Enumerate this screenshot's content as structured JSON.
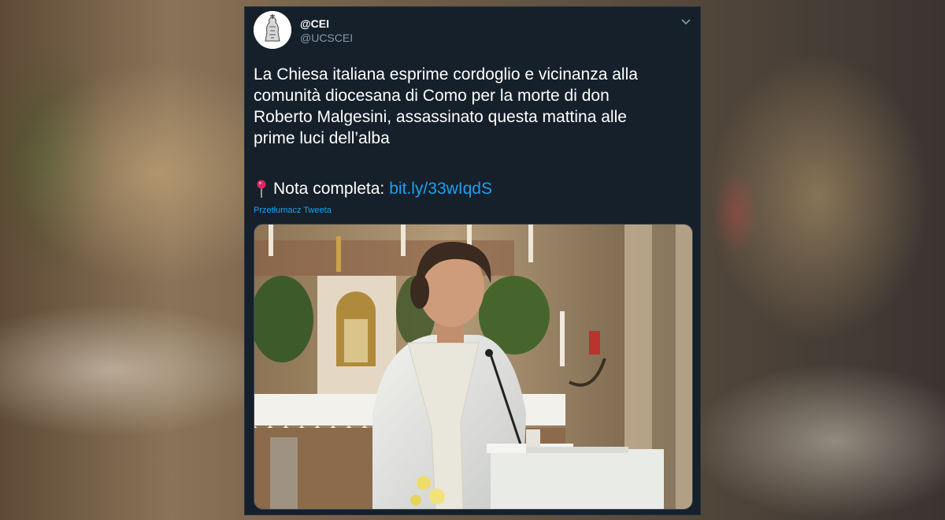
{
  "tweet": {
    "display_name": "@CEI",
    "handle": "@UCSCEI",
    "text": "La Chiesa italiana esprime cordoglio e vicinanza alla\ncomunità diocesana di Como per la morte di don\nRoberto Malgesini, assassinato questa mattina alle\nprime luci dell’alba",
    "nota_label": "Nota completa:",
    "link_text": "bit.ly/33wIqdS",
    "translate_label": "Przetłumacz Tweeta",
    "pin_icon": "round-pushpin-icon",
    "menu_icon": "chevron-down-icon",
    "link_color": "#1da1f2",
    "background_color": "#15202b"
  }
}
